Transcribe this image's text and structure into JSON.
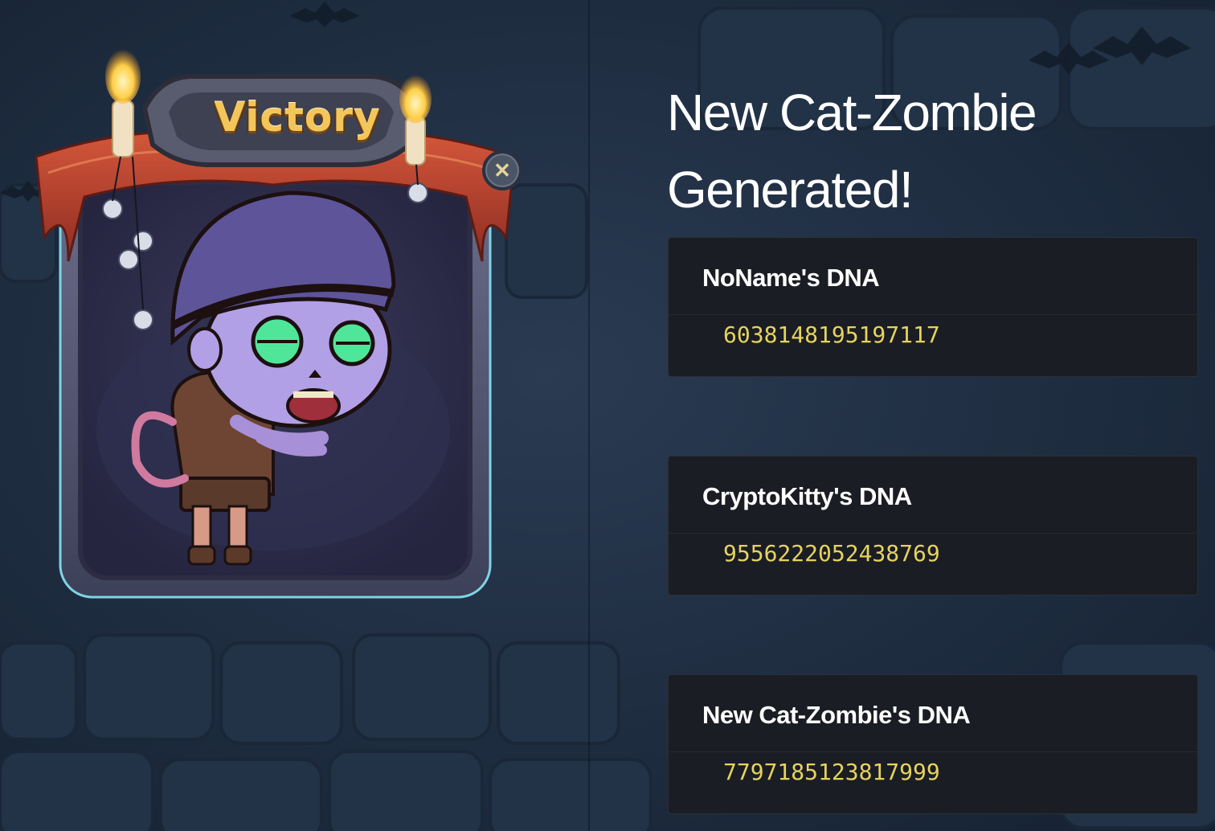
{
  "title": "New Cat-Zombie Generated!",
  "victory_banner": {
    "label": "Victory"
  },
  "close_icon": "close-icon",
  "dna_cards": [
    {
      "label": "NoName's DNA",
      "value": "6038148195197117"
    },
    {
      "label": "CryptoKitty's DNA",
      "value": "9556222052438769"
    },
    {
      "label": "New Cat-Zombie's DNA",
      "value": "7797185123817999"
    }
  ],
  "colors": {
    "background": "#1e2b3c",
    "card_bg": "#1a1d23",
    "dna_value": "#e6d35e",
    "banner_gold": "#f2c65a",
    "ribbon_red": "#b8402c"
  }
}
